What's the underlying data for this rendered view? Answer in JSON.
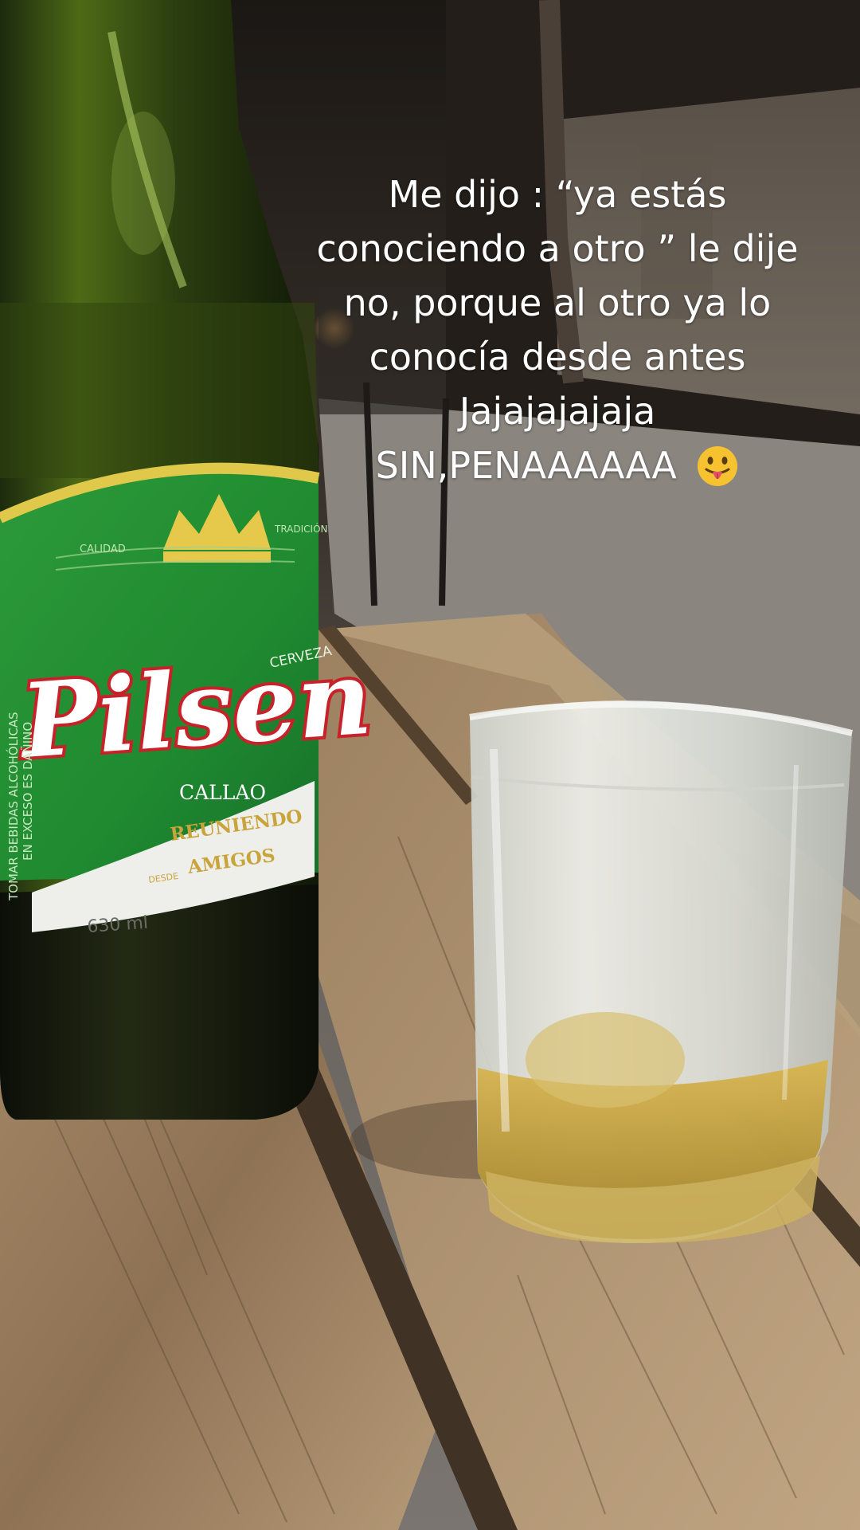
{
  "story": {
    "caption_lines": [
      "Me dijo : “ya estás",
      "conociendo a otro ” le dije",
      "no, porque al otro ya lo",
      "conocía desde antes",
      "Jajajajajaja",
      "SIN,PENAAAAAA"
    ],
    "emoji": "face-with-tongue"
  },
  "photo": {
    "bottle_label": {
      "small_top": "CERVEZA",
      "brand": "Pilsen",
      "city": "CALLAO",
      "slogan_line1": "REUNIENDO",
      "slogan_small": "DESDE",
      "slogan_line2": "AMIGOS",
      "volume": "630 ml",
      "side_text_1": "TOMAR BEBIDAS ALCOHÓLICAS",
      "side_text_2": "EN EXCESO ES DAÑINO",
      "band_left": "CALIDAD",
      "band_right": "TRADICIÓN"
    }
  }
}
